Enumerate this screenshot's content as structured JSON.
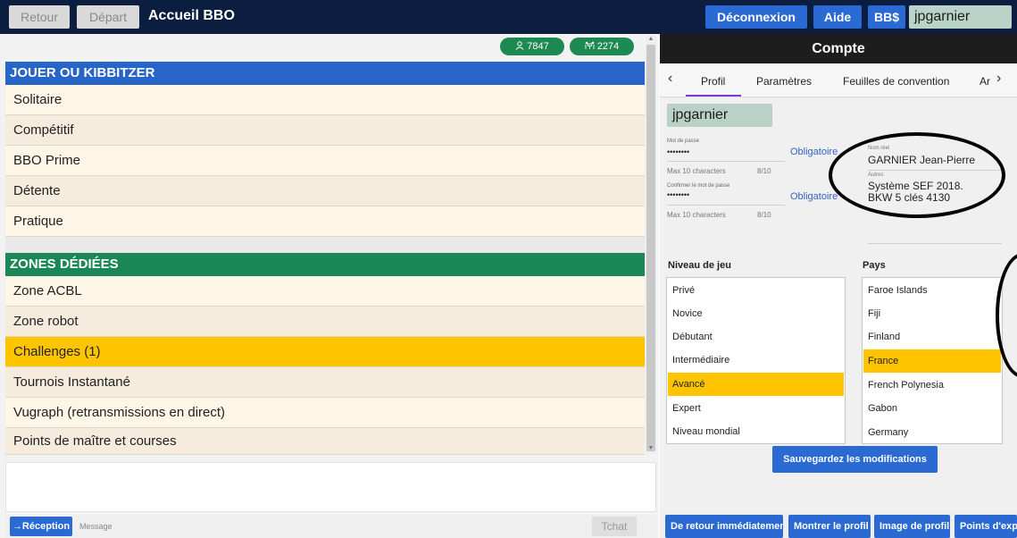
{
  "topbar": {
    "back_label": "Retour",
    "departure_label": "Départ",
    "title": "Accueil BBO",
    "logout_label": "Déconnexion",
    "help_label": "Aide",
    "bbs_label": "BB$",
    "username": "jpgarnier"
  },
  "left": {
    "users_count": "7847",
    "tables_count": "2274",
    "play_header": "JOUER OU KIBBITZER",
    "play_items": [
      "Solitaire",
      "Compétitif",
      "BBO Prime",
      "Détente",
      "Pratique"
    ],
    "zones_header": "ZONES DÉDIÉES",
    "zone_items": [
      "Zone ACBL",
      "Zone robot",
      "Challenges (1)",
      "Tournois Instantané",
      "Vugraph (retransmissions en direct)",
      "Points de maître et courses"
    ],
    "selected_zone_index": 2
  },
  "chat": {
    "reception_label": "→Réception",
    "message_placeholder": "Message",
    "chat_button": "Tchat"
  },
  "account": {
    "title": "Compte",
    "tabs": [
      "Profil",
      "Paramètres",
      "Feuilles de convention",
      "Ar"
    ],
    "active_tab": "Profil",
    "username": "jpgarnier",
    "password_label": "Mot de passe",
    "password_value": "••••••••",
    "password_hint": "Max 10 characters",
    "password_count": "8/10",
    "confirm_label": "Confirmer le mot de passe",
    "confirm_value": "••••••••",
    "confirm_hint": "Max 10 characters",
    "confirm_count": "8/10",
    "required_label": "Obligatoire",
    "real_name_label": "Nom réel",
    "real_name": "GARNIER Jean-Pierre",
    "others_label": "Autres",
    "others_line1": "Système SEF 2018.",
    "others_line2": "BKW 5 clés 4130",
    "level_title": "Niveau de jeu",
    "levels": [
      "Privé",
      "Novice",
      "Débutant",
      "Intermédiaire",
      "Avancé",
      "Expert",
      "Niveau mondial"
    ],
    "selected_level_index": 4,
    "country_title": "Pays",
    "countries": [
      "Faroe Islands",
      "Fiji",
      "Finland",
      "France",
      "French Polynesia",
      "Gabon",
      "Germany"
    ],
    "selected_country_index": 3,
    "save_label": "Sauvegardez les modifications"
  },
  "bottom_buttons": [
    "De retour immédiatement",
    "Montrer le profil",
    "Image de profil",
    "Points d'expérience"
  ],
  "colors": {
    "topbar": "#0b1e3f",
    "brand_blue": "#2a6ad2",
    "play_header": "#2765c9",
    "zones_header": "#1b8657",
    "selection": "#ffc400",
    "badge_green": "#1d8a52"
  }
}
